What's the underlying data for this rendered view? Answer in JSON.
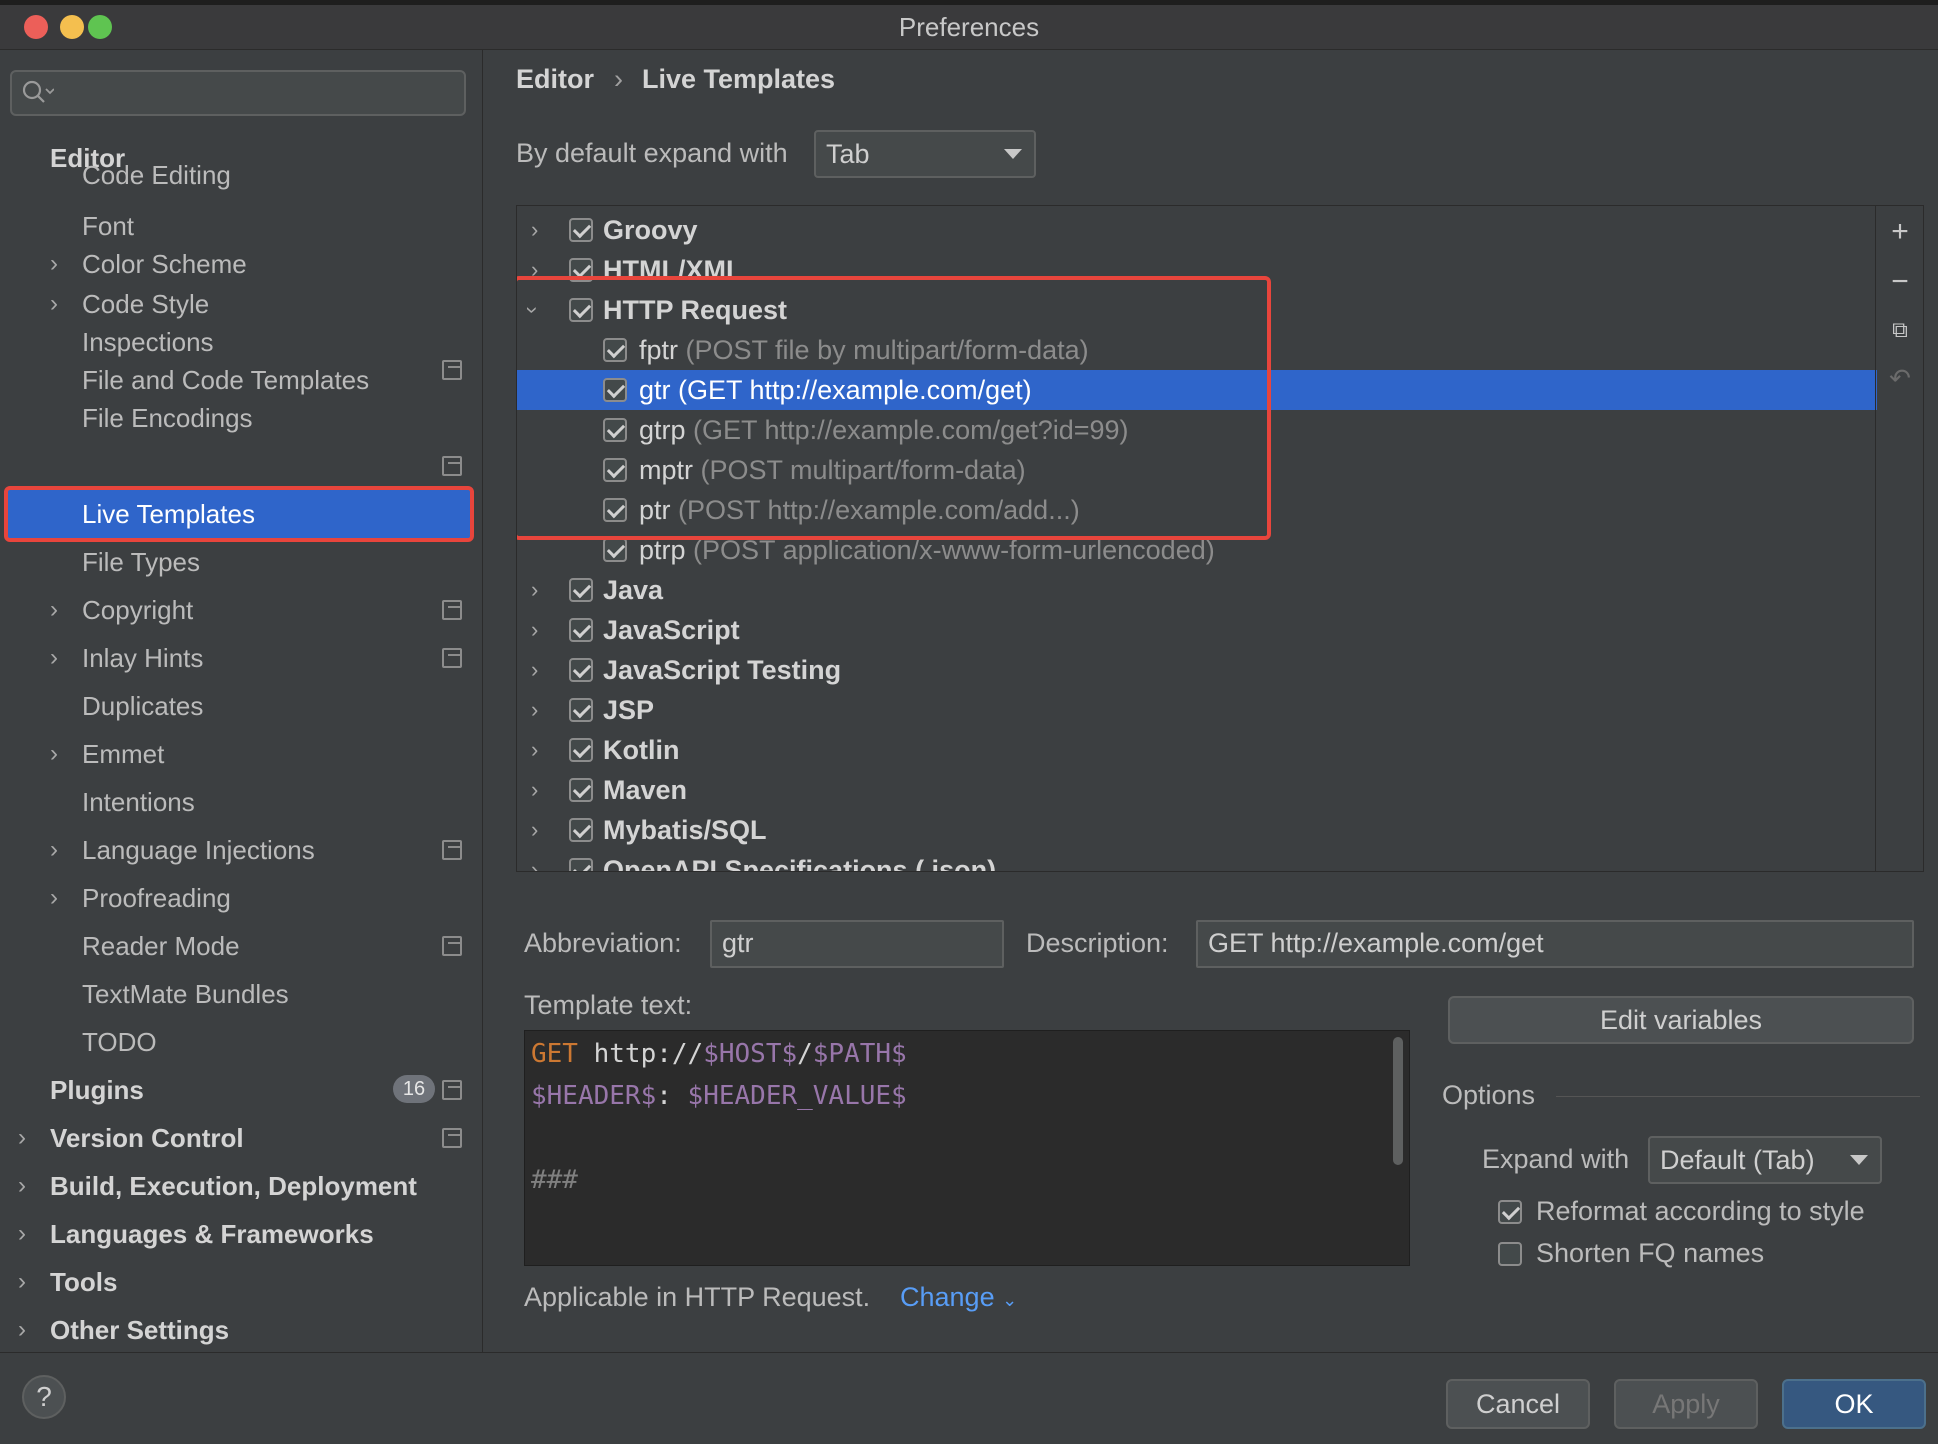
{
  "window": {
    "title": "Preferences"
  },
  "sidebar": {
    "section_editor": "Editor",
    "items": [
      {
        "label": "Code Editing"
      },
      {
        "label": "Font"
      },
      {
        "label": "Color Scheme"
      },
      {
        "label": "Code Style"
      },
      {
        "label": "Inspections"
      },
      {
        "label": "File and Code Templates"
      },
      {
        "label": "File Encodings"
      },
      {
        "label": "Live Templates"
      },
      {
        "label": "File Types"
      },
      {
        "label": "Copyright"
      },
      {
        "label": "Inlay Hints"
      },
      {
        "label": "Duplicates"
      },
      {
        "label": "Emmet"
      },
      {
        "label": "Intentions"
      },
      {
        "label": "Language Injections"
      },
      {
        "label": "Proofreading"
      },
      {
        "label": "Reader Mode"
      },
      {
        "label": "TextMate Bundles"
      },
      {
        "label": "TODO"
      }
    ],
    "top_sections": [
      {
        "label": "Plugins",
        "badge": "16"
      },
      {
        "label": "Version Control"
      },
      {
        "label": "Build, Execution, Deployment"
      },
      {
        "label": "Languages & Frameworks"
      },
      {
        "label": "Tools"
      },
      {
        "label": "Other Settings"
      }
    ]
  },
  "breadcrumb": {
    "first": "Editor",
    "separator": "›",
    "second": "Live Templates"
  },
  "expand": {
    "label": "By default expand with",
    "value": "Tab"
  },
  "template_list": {
    "groups": [
      {
        "name": "Groovy",
        "checked": true
      },
      {
        "name": "HTML/XML",
        "checked": true
      },
      {
        "name": "HTTP Request",
        "checked": true,
        "expanded": true
      },
      {
        "name": "Java",
        "checked": true
      },
      {
        "name": "JavaScript",
        "checked": true
      },
      {
        "name": "JavaScript Testing",
        "checked": true
      },
      {
        "name": "JSP",
        "checked": true
      },
      {
        "name": "Kotlin",
        "checked": true
      },
      {
        "name": "Maven",
        "checked": true
      },
      {
        "name": "Mybatis/SQL",
        "checked": true
      },
      {
        "name": "OpenAPI Specifications (.json)",
        "checked": true
      }
    ],
    "http_items": [
      {
        "abbr": "fptr",
        "desc": "(POST file by multipart/form-data)"
      },
      {
        "abbr": "gtr",
        "desc": "(GET http://example.com/get)"
      },
      {
        "abbr": "gtrp",
        "desc": "(GET http://example.com/get?id=99)"
      },
      {
        "abbr": "mptr",
        "desc": "(POST multipart/form-data)"
      },
      {
        "abbr": "ptr",
        "desc": "(POST http://example.com/add...)"
      },
      {
        "abbr": "ptrp",
        "desc": "(POST application/x-www-form-urlencoded)"
      }
    ],
    "selected": "gtr"
  },
  "details": {
    "abbreviation_label": "Abbreviation:",
    "abbreviation_value": "gtr",
    "description_label": "Description:",
    "description_value": "GET http://example.com/get",
    "template_text_label": "Template text:",
    "code": {
      "l1_kw": "GET",
      "l1_a": " http://",
      "l1_host": "$HOST$",
      "l1_slash": "/",
      "l1_path": "$PATH$",
      "l2_header": "$HEADER$",
      "l2_colon": ": ",
      "l2_value": "$HEADER_VALUE$",
      "l4_comment": "###"
    },
    "edit_variables": "Edit variables",
    "options_title": "Options",
    "expand_with_label": "Expand with",
    "expand_with_value": "Default (Tab)",
    "reformat_label": "Reformat according to style",
    "reformat_checked": true,
    "shorten_label": "Shorten FQ names",
    "shorten_checked": false,
    "applicable_label": "Applicable in HTTP Request.",
    "change_link": "Change"
  },
  "footer": {
    "help": "?",
    "cancel": "Cancel",
    "apply": "Apply",
    "ok": "OK"
  },
  "colors": {
    "selection": "#2f65ca",
    "highlight_box": "#e8453c",
    "link": "#589df6",
    "keyword": "#cc7832",
    "variable": "#9876aa"
  }
}
